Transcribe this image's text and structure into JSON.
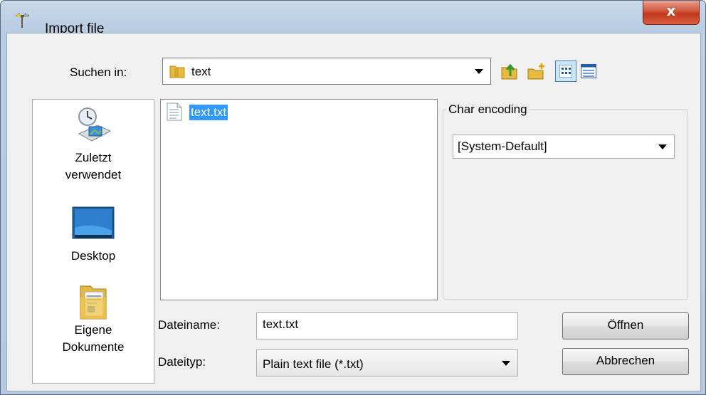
{
  "window": {
    "title": "Import file",
    "close_glyph": "x"
  },
  "lookin": {
    "label": "Suchen in:",
    "value": "text"
  },
  "toolbar": {
    "icons": [
      "up-folder-icon",
      "new-folder-icon",
      "list-view-icon",
      "details-view-icon"
    ]
  },
  "places": [
    {
      "label": "Zuletzt verwendet",
      "icon": "recent-places-icon"
    },
    {
      "label": "Desktop",
      "icon": "desktop-icon"
    },
    {
      "label": "Eigene Dokumente",
      "icon": "documents-folder-icon"
    }
  ],
  "files": [
    {
      "name": "text.txt",
      "icon": "text-file-icon",
      "selected": true
    }
  ],
  "encoding": {
    "group_label": "Char encoding",
    "value": "[System-Default]"
  },
  "filename": {
    "label": "Dateiname:",
    "value": "text.txt"
  },
  "filetype": {
    "label": "Dateityp:",
    "value": "Plain text file (*.txt)"
  },
  "buttons": {
    "open": "Öffnen",
    "cancel": "Abbrechen"
  },
  "colors": {
    "selection": "#3399ff",
    "close_button": "#c3361c",
    "frame": "#b9cde4"
  }
}
